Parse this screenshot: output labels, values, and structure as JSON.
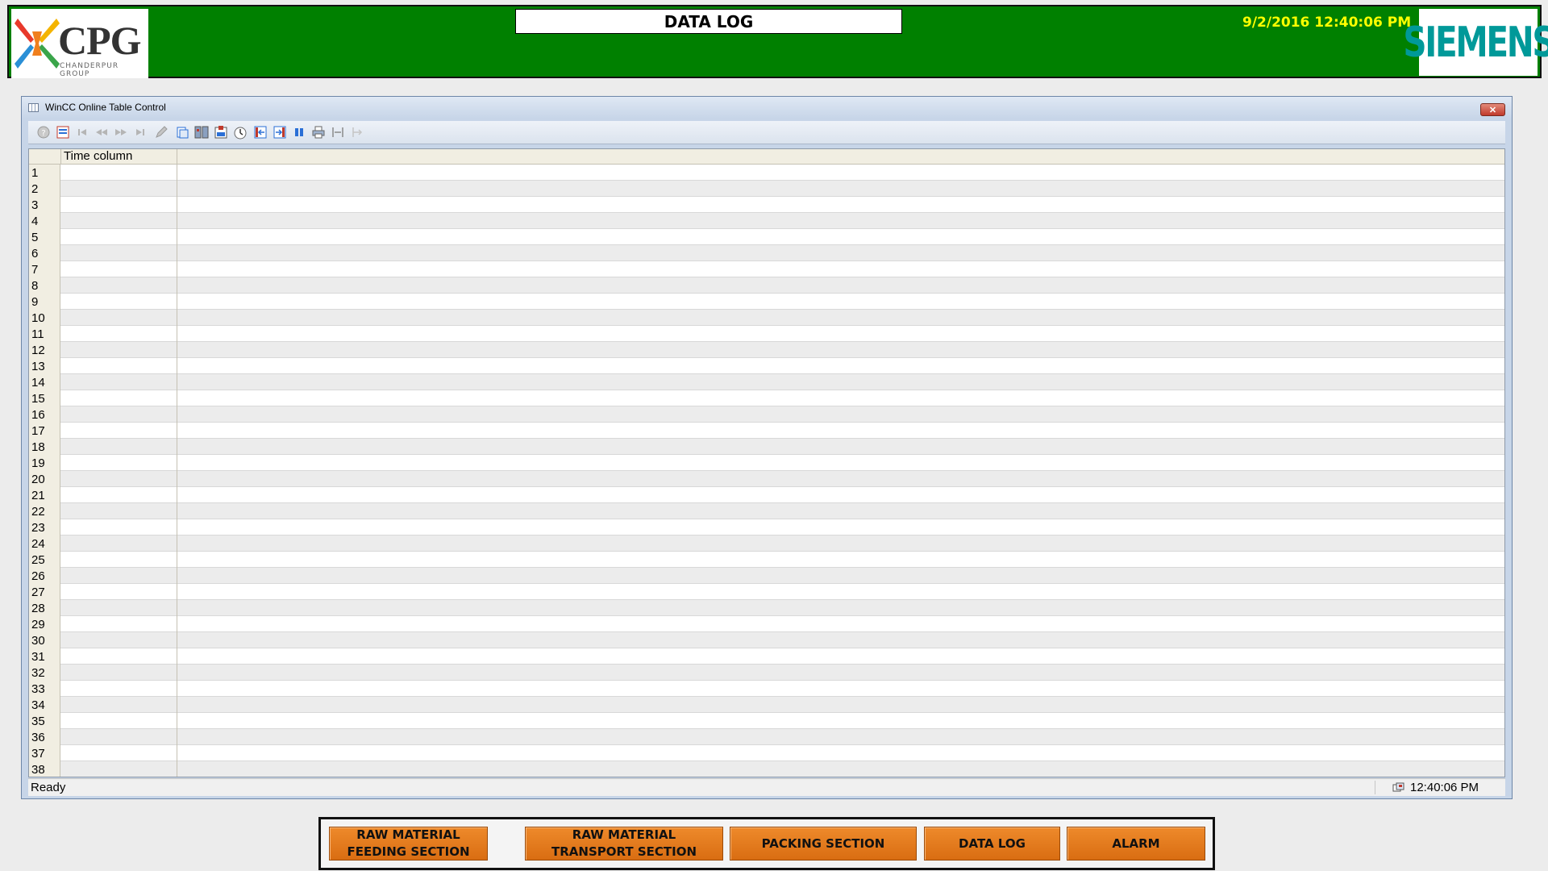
{
  "header": {
    "logo_text": "CPG",
    "logo_subtext": "CHANDERPUR GROUP",
    "title": "DATA LOG",
    "datetime": "9/2/2016 12:40:06 PM",
    "brand": "SIEMENS",
    "bg_color": "#008000",
    "datetime_color": "#ffff00",
    "brand_color": "#009999"
  },
  "table_control": {
    "window_title": "WinCC Online Table Control",
    "close_label": "✕",
    "toolbar_icons": [
      "help-icon",
      "configuration-dialog-icon",
      "first-record-icon",
      "previous-record-icon",
      "next-record-icon",
      "last-record-icon",
      "edit-icon",
      "select-data-connection-icon",
      "select-columns-icon",
      "select-archive-icon",
      "time-range-icon",
      "previous-column-icon",
      "next-column-icon",
      "stop-icon",
      "print-icon",
      "export-icon",
      "ruler-icon"
    ],
    "column_headers": [
      "Time column"
    ],
    "row_numbers": [
      "1",
      "2",
      "3",
      "4",
      "5",
      "6",
      "7",
      "8",
      "9",
      "10",
      "11",
      "12",
      "13",
      "14",
      "15",
      "16",
      "17",
      "18",
      "19",
      "20",
      "21",
      "22",
      "23",
      "24",
      "25",
      "26",
      "27",
      "28",
      "29",
      "30",
      "31",
      "32",
      "33",
      "34",
      "35",
      "36",
      "37",
      "38"
    ],
    "status": "Ready",
    "status_time": "12:40:06 PM"
  },
  "nav": {
    "buttons": [
      {
        "label": "RAW MATERIAL\nFEEDING SECTION"
      },
      {
        "label": "RAW MATERIAL\nTRANSPORT SECTION"
      },
      {
        "label": "PACKING SECTION"
      },
      {
        "label": "DATA LOG"
      },
      {
        "label": "ALARM"
      }
    ],
    "button_color": "#e27a1e"
  }
}
